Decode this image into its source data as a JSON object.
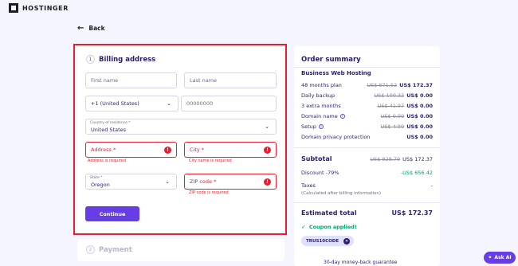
{
  "brand": {
    "name": "HOSTINGER"
  },
  "nav": {
    "back_label": "Back"
  },
  "billing": {
    "step": "1",
    "title": "Billing address",
    "first_name_placeholder": "First name",
    "last_name_placeholder": "Last name",
    "phone_code": "+1 (United States)",
    "phone_placeholder": "00000000",
    "country_label": "Country of residence *",
    "country_value": "United States",
    "address_placeholder": "Address *",
    "address_error": "Address is required",
    "city_placeholder": "City *",
    "city_error": "City name is required",
    "state_label": "State *",
    "state_value": "Oregon",
    "zip_placeholder": "ZIP code *",
    "zip_error": "ZIP code is required",
    "continue_label": "Continue"
  },
  "payment": {
    "step": "2",
    "title": "Payment"
  },
  "order_summary": {
    "title": "Order summary",
    "product": "Business Web Hosting",
    "items": [
      {
        "label": "48 months plan",
        "old": "US$ 671.52",
        "new": "US$ 172.37",
        "help": false
      },
      {
        "label": "Daily backup",
        "old": "US$ 100.32",
        "new": "US$ 0.00",
        "help": false
      },
      {
        "label": "3 extra months",
        "old": "US$ 41.97",
        "new": "US$ 0.00",
        "help": false
      },
      {
        "label": "Domain name",
        "old": "US$ 9.99",
        "new": "US$ 0.00",
        "help": true
      },
      {
        "label": "Setup",
        "old": "US$ 4.99",
        "new": "US$ 0.00",
        "help": true
      },
      {
        "label": "Domain privacy protection",
        "old": "",
        "new": "US$ 0.00",
        "help": false
      }
    ],
    "subtotal_label": "Subtotal",
    "subtotal_old": "US$ 828.79",
    "subtotal_new": "US$ 172.37",
    "discount_label": "Discount -79%",
    "discount_value": "-US$ 656.42",
    "taxes_label": "Taxes",
    "taxes_value": "-",
    "taxes_note": "(Calculated after billing information)",
    "total_label": "Estimated total",
    "total_value": "US$ 172.37",
    "coupon_applied": "Coupon applied!",
    "coupon_code": "TRUS10CODE"
  },
  "footer_hint": "30-day money-back guarantee",
  "ask_ai_label": "Ask AI",
  "colors": {
    "accent": "#673de6",
    "error": "#e5202e",
    "success": "#00a36f",
    "text": "#2f1c6a"
  }
}
